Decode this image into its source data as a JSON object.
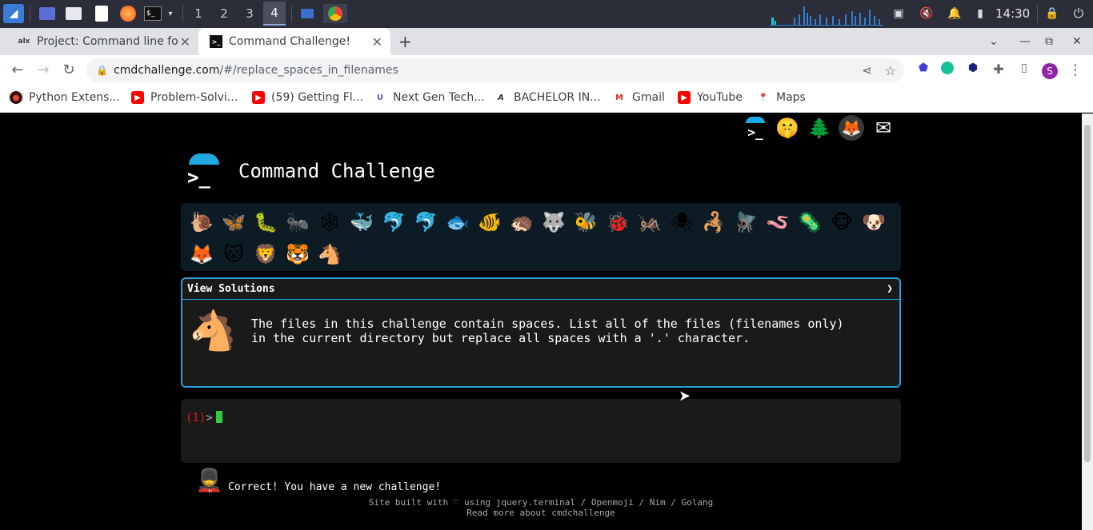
{
  "taskbar": {
    "workspaces": [
      "1",
      "2",
      "3",
      "4"
    ],
    "active_workspace": "4",
    "clock": "14:30"
  },
  "tabs": [
    {
      "favicon": "alx",
      "title": "Project: Command line for",
      "active": false
    },
    {
      "favicon": ">_",
      "title": "Command Challenge!",
      "active": true
    }
  ],
  "addressbar": {
    "domain": "cmdchallenge.com",
    "path": "/#/replace_spaces_in_filenames",
    "profile_initial": "S"
  },
  "bookmarks": [
    {
      "label": "Python Extens...",
      "icon": "python-icon",
      "color": "#c0392b"
    },
    {
      "label": "Problem-Solvi...",
      "icon": "youtube-icon",
      "color": "#ff0000"
    },
    {
      "label": "(59) Getting Fl...",
      "icon": "youtube-icon",
      "color": "#ff0000"
    },
    {
      "label": "Next Gen Tech...",
      "icon": "udacity-icon",
      "color": "#5f52c4"
    },
    {
      "label": "BACHELOR IN...",
      "icon": "ai-icon",
      "color": "#333333"
    },
    {
      "label": "Gmail",
      "icon": "gmail-icon",
      "color": "#d93025"
    },
    {
      "label": "YouTube",
      "icon": "youtube-icon",
      "color": "#ff0000"
    },
    {
      "label": "Maps",
      "icon": "maps-icon",
      "color": "#34a853"
    }
  ],
  "page": {
    "brand_title": "Command Challenge",
    "logo_prompt": ">_",
    "top_icons": [
      "terminal-icon",
      "shushing-face-icon",
      "tree-icon",
      "gitlab-icon",
      "mail-icon"
    ],
    "animals": [
      "🐌",
      "🦋",
      "🐛",
      "🐜",
      "🕸",
      "🐳",
      "🐬",
      "🐬",
      "🐟",
      "🐠",
      "🦔",
      "🐺",
      "🐝",
      "🐞",
      "🦗",
      "🕷",
      "🦂",
      "🪰",
      "🪱",
      "🦠",
      "🐵",
      "🐶",
      "🦊",
      "🐱",
      "🦁",
      "🐯",
      "🐴"
    ],
    "view_solutions": "View Solutions",
    "chevron": "❯",
    "challenge_text": "The files in this challenge contain spaces. List all of the files (filenames only)\nin the current directory but replace all spaces with a '.' character.",
    "prompt_number": "(1)",
    "prompt_symbol": ">",
    "success_message": "Correct! You have a new challenge!",
    "footer_line1": "Site built with ♡ using jquery.terminal / Openmoji / Nim / Golang",
    "footer_line2": "Read more about cmdchallenge"
  },
  "colors": {
    "accent": "#2a9fd6",
    "prompt_number": "#d81b1b",
    "cursor": "#2ecc40",
    "page_bg": "#000000"
  }
}
